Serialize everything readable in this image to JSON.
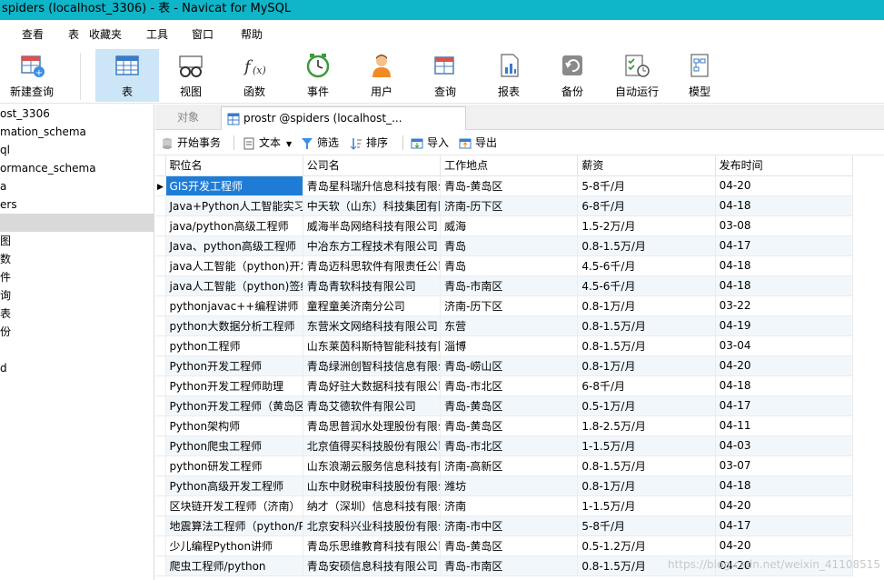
{
  "window": {
    "title": "spiders (localhost_3306) - 表 - Navicat for MySQL"
  },
  "menu": [
    "查看",
    "表",
    "收藏夹",
    "工具",
    "窗口",
    "帮助"
  ],
  "toolbar": {
    "new_query": "新建查询",
    "table": "表",
    "view": "视图",
    "function": "函数",
    "event": "事件",
    "user": "用户",
    "query": "查询",
    "report": "报表",
    "backup": "备份",
    "automation": "自动运行",
    "model": "模型"
  },
  "sidebar": {
    "items": [
      "ost_3306",
      "mation_schema",
      "ql",
      "ormance_schema",
      "a",
      "ers",
      "",
      "图",
      "数",
      "件",
      "询",
      "表",
      "份",
      "",
      "d"
    ]
  },
  "tabs": {
    "objects": "对象",
    "active": "prostr @spiders (localhost_..."
  },
  "subtoolbar": {
    "begin_transaction": "开始事务",
    "text": "文本",
    "filter": "筛选",
    "sort": "排序",
    "import": "导入",
    "export": "导出"
  },
  "table": {
    "columns": [
      "职位名",
      "公司名",
      "工作地点",
      "薪资",
      "发布时间"
    ],
    "rows": [
      [
        "GIS开发工程师",
        "青岛星科瑞升信息科技有限公司",
        "青岛-黄岛区",
        "5-8千/月",
        "04-20"
      ],
      [
        "Java+Python人工智能实习生",
        "中天软（山东）科技集团有限公司",
        "济南-历下区",
        "6-8千/月",
        "04-18"
      ],
      [
        "java/python高级工程师",
        "威海半岛网络科技有限公司",
        "威海",
        "1.5-2万/月",
        "03-08"
      ],
      [
        "Java、python高级工程师",
        "中冶东方工程技术有限公司",
        "青岛",
        "0.8-1.5万/月",
        "04-17"
      ],
      [
        "java人工智能（python)开发",
        "青岛迈科思软件有限责任公司",
        "青岛",
        "4.5-6千/月",
        "04-18"
      ],
      [
        "java人工智能（python)签约",
        "青岛青软科技有限公司",
        "青岛-市南区",
        "4.5-6千/月",
        "04-18"
      ],
      [
        "pythonjavac++编程讲师（",
        "童程童美济南分公司",
        "济南-历下区",
        "0.8-1万/月",
        "03-22"
      ],
      [
        "python大数据分析工程师",
        "东营米文网络科技有限公司",
        "东营",
        "0.8-1.5万/月",
        "04-19"
      ],
      [
        "python工程师",
        "山东莱茵科斯特智能科技有限公司",
        "淄博",
        "0.8-1.5万/月",
        "03-04"
      ],
      [
        "Python开发工程师",
        "青岛绿洲创智科技信息有限公司",
        "青岛-崂山区",
        "0.8-1万/月",
        "04-20"
      ],
      [
        "Python开发工程师助理",
        "青岛好驻大数据科技有限公司",
        "青岛-市北区",
        "6-8千/月",
        "04-18"
      ],
      [
        "Python开发工程师（黄岛区",
        "青岛艾德软件有限公司",
        "青岛-黄岛区",
        "0.5-1万/月",
        "04-17"
      ],
      [
        "Python架构师",
        "青岛思普润水处理股份有限公司",
        "青岛-黄岛区",
        "1.8-2.5万/月",
        "04-11"
      ],
      [
        "Python爬虫工程师",
        "北京值得买科技股份有限公司",
        "青岛-市北区",
        "1-1.5万/月",
        "04-03"
      ],
      [
        "python研发工程师",
        "山东浪潮云服务信息科技有限公司",
        "济南-高新区",
        "0.8-1.5万/月",
        "03-07"
      ],
      [
        "Python高级开发工程师",
        "山东中财税审科技股份有限公司",
        "潍坊",
        "0.8-1万/月",
        "04-18"
      ],
      [
        "区块链开发工程师（济南）",
        "纳才（深圳）信息科技有限公司",
        "济南",
        "1-1.5万/月",
        "04-20"
      ],
      [
        "地震算法工程师（python/P",
        "北京安科兴业科技股份有限公司",
        "济南-市中区",
        "5-8千/月",
        "04-17"
      ],
      [
        "少儿编程Python讲师",
        "青岛乐思维教育科技有限公司",
        "青岛-黄岛区",
        "0.5-1.2万/月",
        "04-20"
      ],
      [
        "爬虫工程师/python",
        "青岛安硕信息科技有限公司",
        "青岛-市南区",
        "0.8-1.5万/月",
        "04-20"
      ]
    ]
  },
  "watermark": "https://blog.csdn.net/weixin_41108515",
  "colors": {
    "titlebar": "#0fb5c8",
    "selection": "#1f7cd6",
    "active_tool": "#cde6f7"
  }
}
